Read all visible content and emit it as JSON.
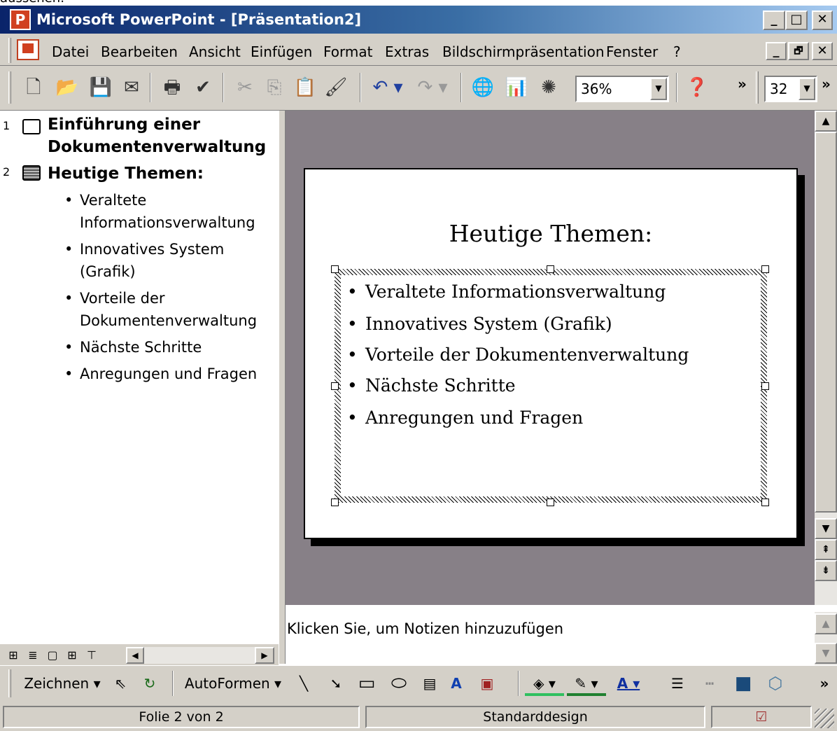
{
  "caption_fragment": "aussehen:",
  "window": {
    "app_icon_glyph": "P",
    "title": "Microsoft PowerPoint - [Präsentation2]",
    "minimize": "_",
    "maximize": "□",
    "close": "✕",
    "restore": "🗗"
  },
  "menu": {
    "items": [
      "Datei",
      "Bearbeiten",
      "Ansicht",
      "Einfügen",
      "Format",
      "Extras",
      "Bildschirmpräsentation",
      "Fenster",
      "?"
    ]
  },
  "toolbar": {
    "zoom": "36%",
    "font_size": "32",
    "more": "»"
  },
  "outline": {
    "slides": [
      {
        "number": "1",
        "title_line1": "Einführung einer",
        "title_line2": "Dokumentenverwaltung"
      },
      {
        "number": "2",
        "title": "Heutige Themen:"
      }
    ],
    "bullets": [
      "Veraltete",
      "Informationsverwaltung",
      "Innovatives System",
      "(Grafik)",
      "Vorteile der",
      "Dokumentenverwaltung",
      "Nächste Schritte",
      "Anregungen und Fragen"
    ]
  },
  "slide": {
    "title": "Heutige Themen:",
    "bullets": [
      "Veraltete Informationsverwaltung",
      "Innovatives System (Grafik)",
      "Vorteile der Dokumentenverwaltung",
      "Nächste Schritte",
      "Anregungen und Fragen"
    ]
  },
  "notes": {
    "placeholder": "Klicken Sie, um Notizen hinzuzufügen"
  },
  "drawing_toolbar": {
    "draw_menu": "Zeichnen ▾",
    "autoshapes_menu": "AutoFormen ▾"
  },
  "status": {
    "slide_position": "Folie 2 von 2",
    "design": "Standarddesign"
  },
  "colors": {
    "title_bar_start": "#0a246a",
    "title_bar_end": "#a6caf0",
    "slide_area_bg": "#878087",
    "chrome": "#d4d0c8"
  },
  "icons": [
    "new-icon",
    "open-icon",
    "save-icon",
    "email-icon",
    "print-icon",
    "spelling-icon",
    "cut-icon",
    "copy-icon",
    "paste-icon",
    "format-painter-icon",
    "undo-icon",
    "redo-icon",
    "web-icon",
    "chart-icon",
    "expand-icon",
    "help-icon"
  ]
}
